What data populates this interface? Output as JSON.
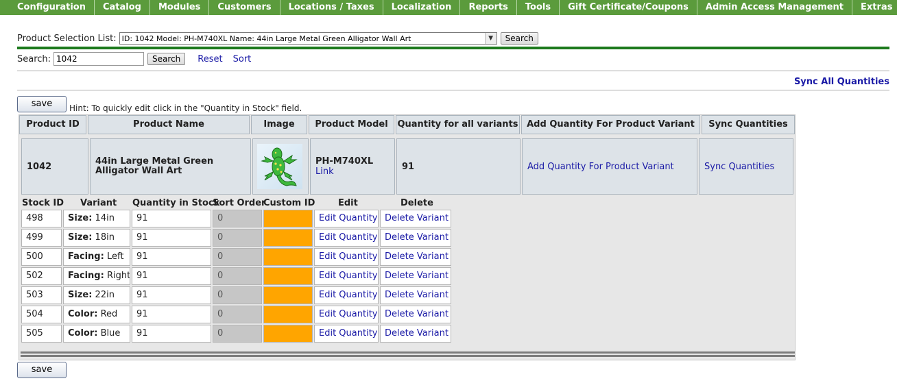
{
  "nav": [
    "Configuration",
    "Catalog",
    "Modules",
    "Customers",
    "Locations / Taxes",
    "Localization",
    "Reports",
    "Tools",
    "Gift Certificate/Coupons",
    "Admin Access Management",
    "Extras"
  ],
  "product_selection": {
    "label": "Product Selection List:",
    "selected": "ID:  1042  Model:  PH-M740XL  Name:  44in Large Metal Green Alligator Wall Art",
    "search_button": "Search"
  },
  "search": {
    "label": "Search:",
    "value": "1042",
    "button": "Search",
    "reset": "Reset",
    "sort": "Sort"
  },
  "sync_all": "Sync All Quantities",
  "save_label": "save",
  "hint": "Hint: To quickly edit click in the \"Quantity in Stock\" field.",
  "table": {
    "headers": [
      "Product ID",
      "Product Name",
      "Image",
      "Product Model",
      "Quantity for all variants",
      "Add Quantity For Product Variant",
      "Sync Quantities"
    ],
    "product": {
      "id": "1042",
      "name": "44in Large Metal Green Alligator Wall Art",
      "model": "PH-M740XL",
      "model_link": "Link",
      "quantity": "91",
      "add_link": "Add Quantity For Product Variant",
      "sync_link": "Sync Quantities"
    },
    "variant_headers": [
      "Stock ID",
      "Variant",
      "Quantity in Stock",
      "Sort Order",
      "Custom ID",
      "Edit",
      "Delete"
    ],
    "variants": [
      {
        "stock_id": "498",
        "attr": "Size:",
        "val": "14in",
        "qty": "91",
        "sort": "0",
        "edit": "Edit Quantity",
        "del": "Delete Variant"
      },
      {
        "stock_id": "499",
        "attr": "Size:",
        "val": "18in",
        "qty": "91",
        "sort": "0",
        "edit": "Edit Quantity",
        "del": "Delete Variant"
      },
      {
        "stock_id": "500",
        "attr": "Facing:",
        "val": "Left",
        "qty": "91",
        "sort": "0",
        "edit": "Edit Quantity",
        "del": "Delete Variant"
      },
      {
        "stock_id": "502",
        "attr": "Facing:",
        "val": "Right",
        "qty": "91",
        "sort": "0",
        "edit": "Edit Quantity",
        "del": "Delete Variant"
      },
      {
        "stock_id": "503",
        "attr": "Size:",
        "val": "22in",
        "qty": "91",
        "sort": "0",
        "edit": "Edit Quantity",
        "del": "Delete Variant"
      },
      {
        "stock_id": "504",
        "attr": "Color:",
        "val": "Red",
        "qty": "91",
        "sort": "0",
        "edit": "Edit Quantity",
        "del": "Delete Variant"
      },
      {
        "stock_id": "505",
        "attr": "Color:",
        "val": "Blue",
        "qty": "91",
        "sort": "0",
        "edit": "Edit Quantity",
        "del": "Delete Variant"
      }
    ]
  },
  "colors": {
    "nav_bg": "#5b9b3c",
    "divider": "#1d7a1d",
    "cell_bg": "#dde3e8",
    "custom_id": "#ffa500",
    "sort_bg": "#c6c6c6",
    "link": "#1a1aa6"
  },
  "icons": {
    "select_arrow": "chevron-down-icon",
    "product_image": "green-alligator-image"
  }
}
